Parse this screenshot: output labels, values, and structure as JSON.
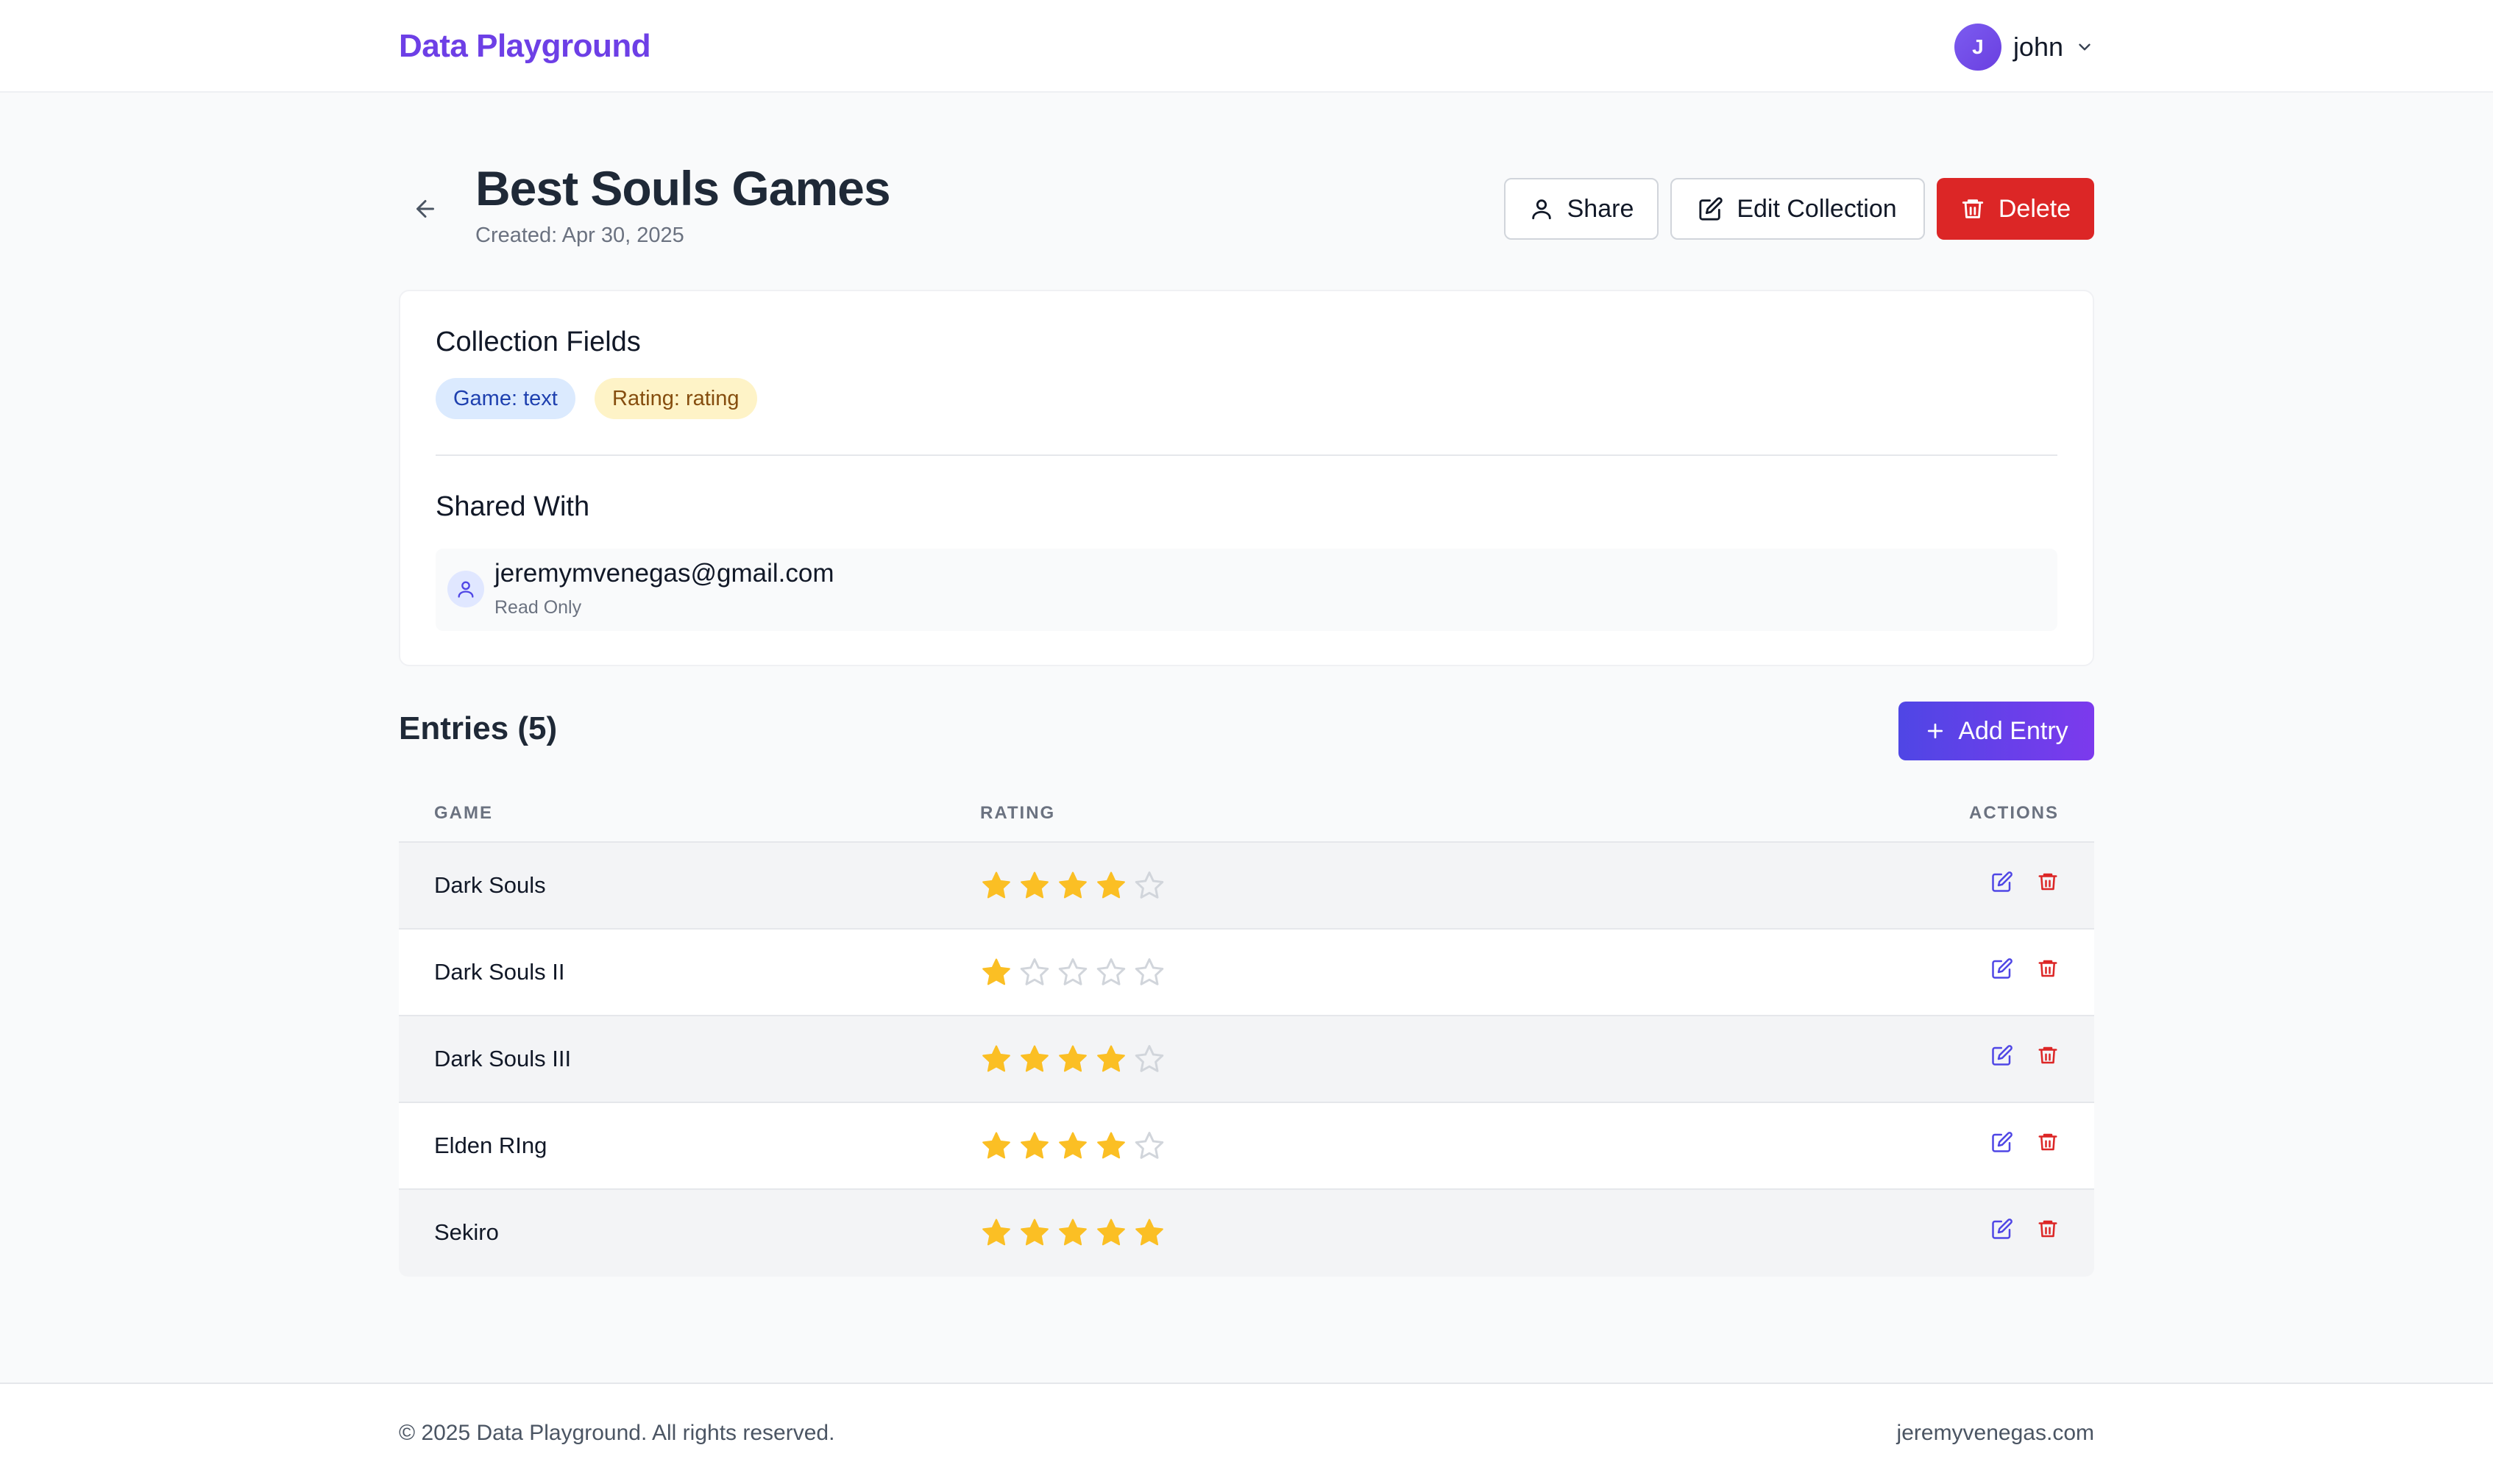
{
  "header": {
    "brand": "Data Playground",
    "avatar_initial": "J",
    "username": "john"
  },
  "page": {
    "title": "Best Souls Games",
    "created": "Created: Apr 30, 2025"
  },
  "actions": {
    "share": "Share",
    "edit": "Edit Collection",
    "delete": "Delete"
  },
  "fields": {
    "title": "Collection Fields",
    "items": [
      {
        "label": "Game: text"
      },
      {
        "label": "Rating: rating"
      }
    ]
  },
  "shared": {
    "title": "Shared With",
    "users": [
      {
        "email": "jeremymvenegas@gmail.com",
        "permission": "Read Only"
      }
    ]
  },
  "entries": {
    "title": "Entries (5)",
    "add_label": "Add Entry",
    "columns": {
      "game": "GAME",
      "rating": "RATING",
      "actions": "ACTIONS"
    },
    "max_rating": 5,
    "rows": [
      {
        "game": "Dark Souls",
        "rating": 4
      },
      {
        "game": "Dark Souls II",
        "rating": 1
      },
      {
        "game": "Dark Souls III",
        "rating": 4
      },
      {
        "game": "Elden RIng",
        "rating": 4
      },
      {
        "game": "Sekiro",
        "rating": 5
      }
    ]
  },
  "colors": {
    "brand": "#6d3fe6",
    "danger": "#dc2626",
    "star_filled": "#fbbf24",
    "star_empty": "#d1d5db",
    "edit_icon": "#4f46e5"
  },
  "footer": {
    "copyright": "© 2025 Data Playground. All rights reserved.",
    "link": "jeremyvenegas.com"
  }
}
